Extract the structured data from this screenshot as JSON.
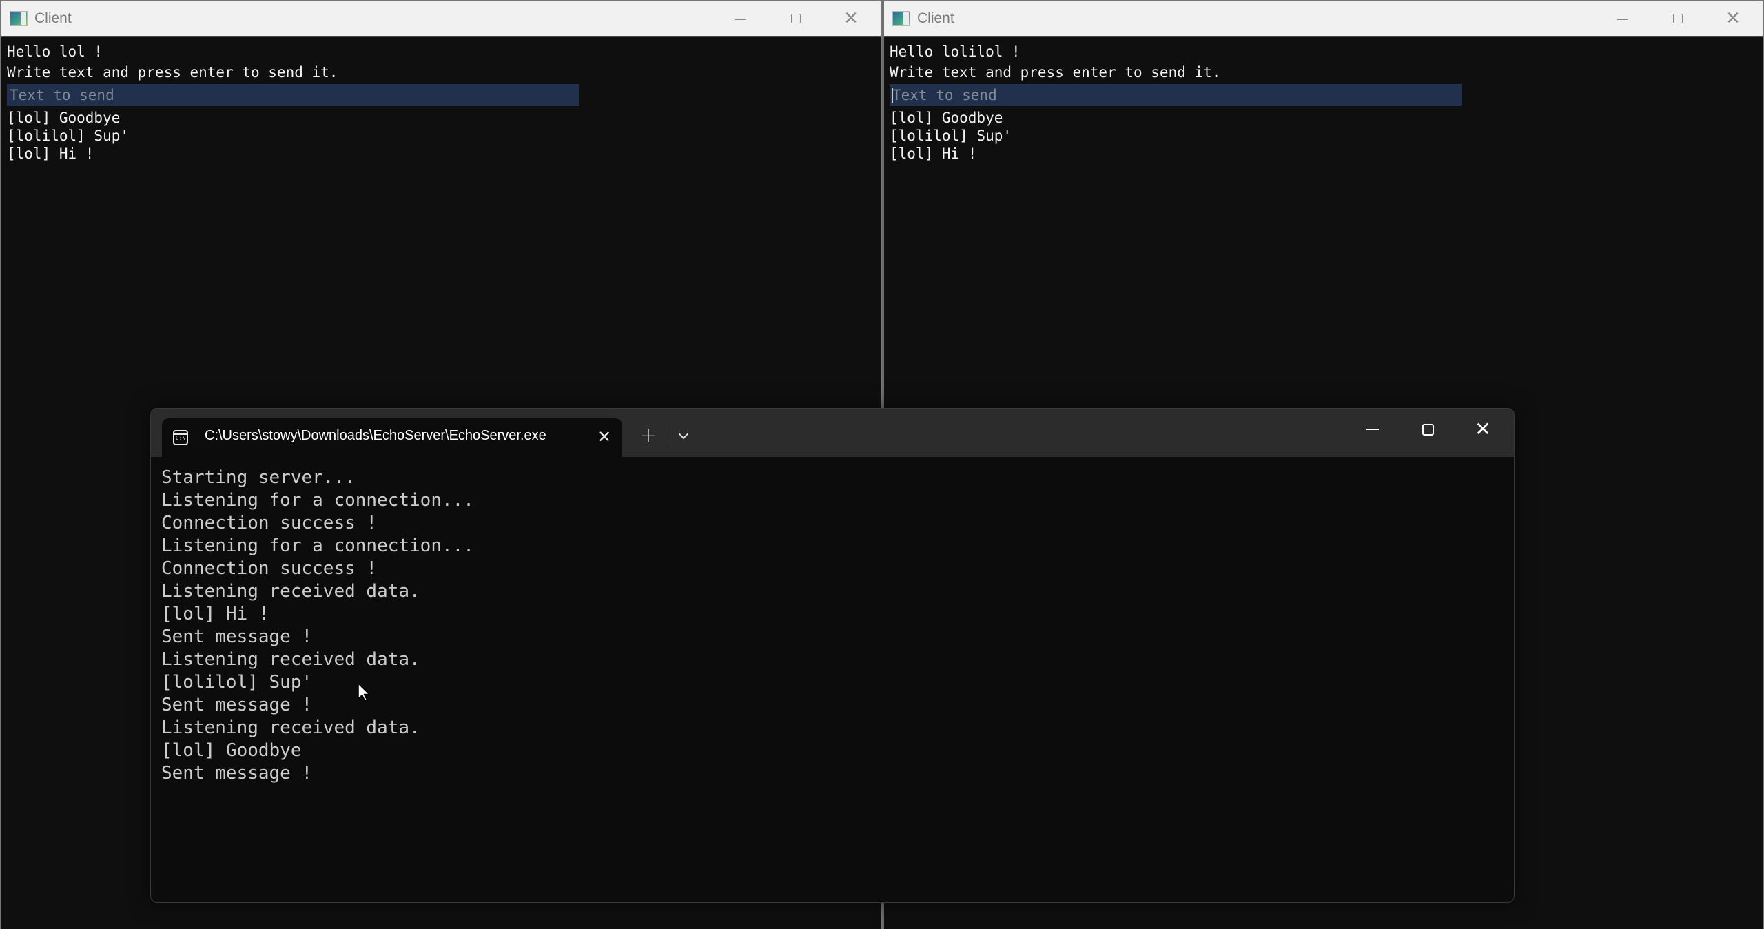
{
  "clients": [
    {
      "title": "Client",
      "greeting": "Hello lol !",
      "instruction": "Write text and press enter to send it.",
      "input": {
        "value": "",
        "placeholder": "Text to send",
        "focused": false
      },
      "messages": [
        "[lol] Goodbye",
        "[lolilol] Sup'",
        "[lol] Hi !"
      ],
      "controls": {
        "minimize": "minimize-icon",
        "maximize": "maximize-icon",
        "close": "close-icon"
      }
    },
    {
      "title": "Client",
      "greeting": "Hello lolilol !",
      "instruction": "Write text and press enter to send it.",
      "input": {
        "value": "",
        "placeholder": "Text to send",
        "focused": true
      },
      "messages": [
        "[lol] Goodbye",
        "[lolilol] Sup'",
        "[lol] Hi !"
      ],
      "controls": {
        "minimize": "minimize-icon",
        "maximize": "maximize-icon",
        "close": "close-icon"
      }
    }
  ],
  "terminal": {
    "tab": {
      "icon": "console-icon",
      "icon_text": "C:\\",
      "title": "C:\\Users\\stowy\\Downloads\\EchoServer\\EchoServer.exe",
      "close_glyph": "✕"
    },
    "new_tab_glyph": "+",
    "close_glyph": "✕",
    "output": [
      "Starting server...",
      "Listening for a connection...",
      "Connection success !",
      "Listening for a connection...",
      "Connection success !",
      "Listening received data.",
      "[lol] Hi !",
      "Sent message !",
      "Listening received data.",
      "[lolilol] Sup'",
      "Sent message !",
      "Listening received data.",
      "[lol] Goodbye",
      "Sent message !"
    ]
  },
  "colors": {
    "client_bg": "#0f0f0f",
    "client_titlebar": "#f1f1f1",
    "input_bg": "#21304c",
    "placeholder": "#828a95",
    "terminal_bg": "#0c0c0c",
    "terminal_tabbar": "#2c2c2c",
    "terminal_text": "#cccccc"
  }
}
